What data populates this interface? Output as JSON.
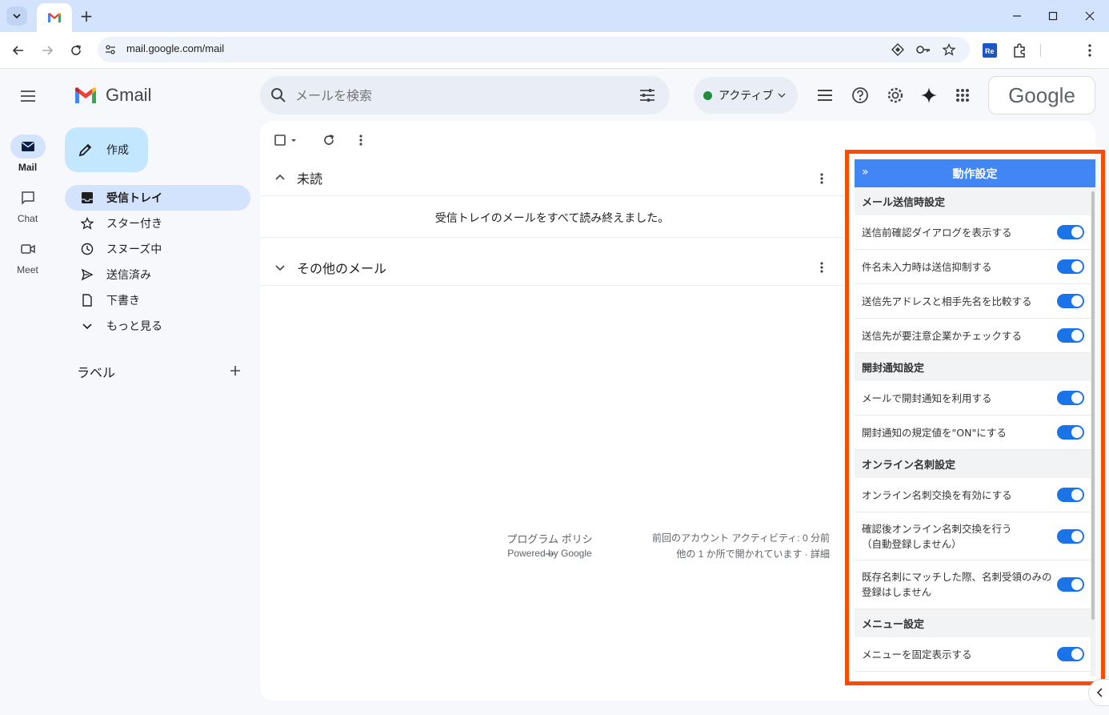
{
  "browser": {
    "url": "mail.google.com/mail"
  },
  "gmail": {
    "logo_text": "Gmail",
    "rail": [
      {
        "label": "Mail"
      },
      {
        "label": "Chat"
      },
      {
        "label": "Meet"
      }
    ],
    "compose_label": "作成",
    "nav": [
      {
        "label": "受信トレイ"
      },
      {
        "label": "スター付き"
      },
      {
        "label": "スヌーズ中"
      },
      {
        "label": "送信済み"
      },
      {
        "label": "下書き"
      },
      {
        "label": "もっと見る"
      }
    ],
    "labels_title": "ラベル",
    "search_placeholder": "メールを検索",
    "status_label": "アクティブ",
    "google_text": "Google",
    "sections": {
      "unread_title": "未読",
      "unread_empty": "受信トレイのメールをすべて読み終えました。",
      "other_title": "その他のメール"
    },
    "footer": {
      "policy": "プログラム ポリシー",
      "powered": "Powered by Google",
      "activity": "前回のアカウント アクティビティ: 0 分前",
      "other_places": "他の 1 か所で開かれています · 詳細"
    }
  },
  "panel": {
    "title": "動作設定",
    "sections": [
      {
        "title": "メール送信時設定"
      },
      {
        "title": "開封通知設定"
      },
      {
        "title": "オンライン名刺設定"
      },
      {
        "title": "メニュー設定"
      }
    ],
    "rows": [
      "送信前確認ダイアログを表示する",
      "件名未入力時は送信抑制する",
      "送信先アドレスと相手先名を比較する",
      "送信先が要注意企業かチェックする",
      "メールで開封通知を利用する",
      "開封通知の規定値を\"ON\"にする",
      "オンライン名刺交換を有効にする",
      "確認後オンライン名刺交換を行う（自動登録しません）",
      "既存名刺にマッチした際、名刺受領のみの登録はしません",
      "メニューを固定表示する"
    ],
    "row_line2": {
      "r7": "（自動登録しません）",
      "r8": "登録はしません"
    },
    "row_line1": {
      "r7": "確認後オンライン名刺交換を行う",
      "r8": "既存名刺にマッチした際、名刺受領のみの"
    },
    "toggles_on": [
      true,
      true,
      true,
      true,
      true,
      true,
      true,
      true,
      true,
      true
    ]
  },
  "colors": {
    "accent": "#1a73e8",
    "panel_header": "#4285f4",
    "highlight_border": "#ff4a00",
    "status_green": "#1e8e3e"
  }
}
